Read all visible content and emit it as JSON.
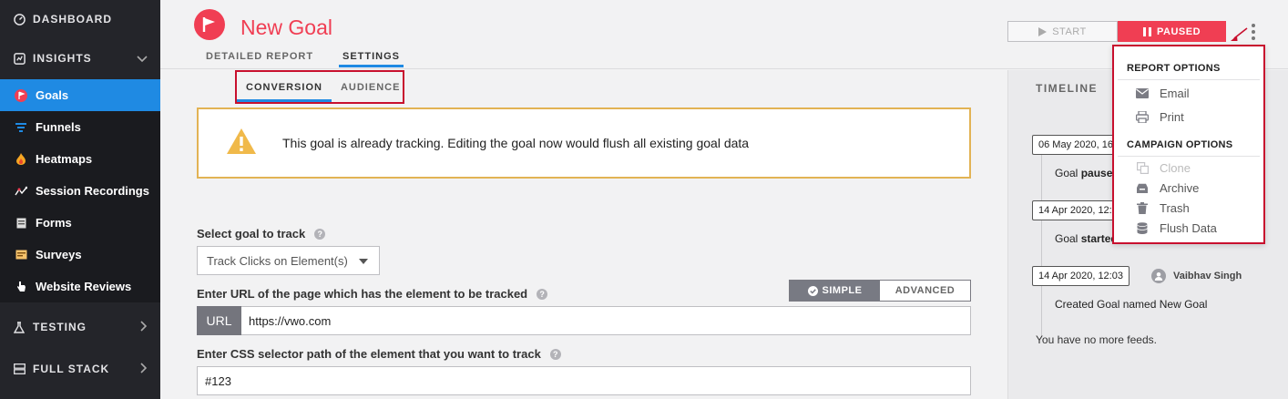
{
  "sidebar": {
    "dashboard": "DASHBOARD",
    "insights": "INSIGHTS",
    "items": [
      {
        "label": "Goals",
        "icon": "goal-flag-icon"
      },
      {
        "label": "Funnels",
        "icon": "funnel-icon"
      },
      {
        "label": "Heatmaps",
        "icon": "flame-icon"
      },
      {
        "label": "Session Recordings",
        "icon": "recording-icon"
      },
      {
        "label": "Forms",
        "icon": "form-icon"
      },
      {
        "label": "Surveys",
        "icon": "survey-icon"
      },
      {
        "label": "Website Reviews",
        "icon": "hand-pointer-icon"
      }
    ],
    "testing": "TESTING",
    "full_stack": "FULL STACK"
  },
  "header": {
    "title": "New Goal",
    "tabs": [
      "DETAILED REPORT",
      "SETTINGS"
    ],
    "start_label": "START",
    "paused_label": "PAUSED"
  },
  "subtabs": [
    "CONVERSION",
    "AUDIENCE"
  ],
  "warning": "This goal is already tracking. Editing the goal now would flush all existing goal data",
  "form": {
    "goal_label": "Select goal to track",
    "goal_value": "Track Clicks on Element(s)",
    "url_label": "Enter URL of the page which has the element to be tracked",
    "mode_simple": "SIMPLE",
    "mode_advanced": "ADVANCED",
    "url_prefix": "URL",
    "url_value": "https://vwo.com",
    "css_label": "Enter CSS selector path of the element that you want to track",
    "css_value": "#123"
  },
  "timeline": {
    "title": "TIMELINE",
    "events": [
      {
        "date": "06 May 2020, 16",
        "text_prefix": "Goal ",
        "text_bold": "paused"
      },
      {
        "date": "14 Apr 2020, 12:",
        "text_prefix": "Goal ",
        "text_bold": "started"
      },
      {
        "date": "14 Apr 2020, 12:03",
        "user": "Vaibhav Singh",
        "text_prefix": "Created Goal named New Goal",
        "text_bold": ""
      }
    ],
    "end_text": "You have no more feeds."
  },
  "dropdown": {
    "report_options": "REPORT OPTIONS",
    "report_items": [
      {
        "label": "Email",
        "icon": "envelope-icon",
        "disabled": false
      },
      {
        "label": "Print",
        "icon": "printer-icon",
        "disabled": false
      }
    ],
    "campaign_options": "CAMPAIGN OPTIONS",
    "campaign_items": [
      {
        "label": "Clone",
        "icon": "clone-icon",
        "disabled": true
      },
      {
        "label": "Archive",
        "icon": "archive-icon",
        "disabled": false
      },
      {
        "label": "Trash",
        "icon": "trash-icon",
        "disabled": false
      },
      {
        "label": "Flush Data",
        "icon": "database-icon",
        "disabled": false
      }
    ]
  },
  "colors": {
    "brand": "#f03e53",
    "accent": "#1f8ae3",
    "sidebar": "#24252a",
    "highlight_border": "#c8102e",
    "warning_border": "#e2b354"
  }
}
